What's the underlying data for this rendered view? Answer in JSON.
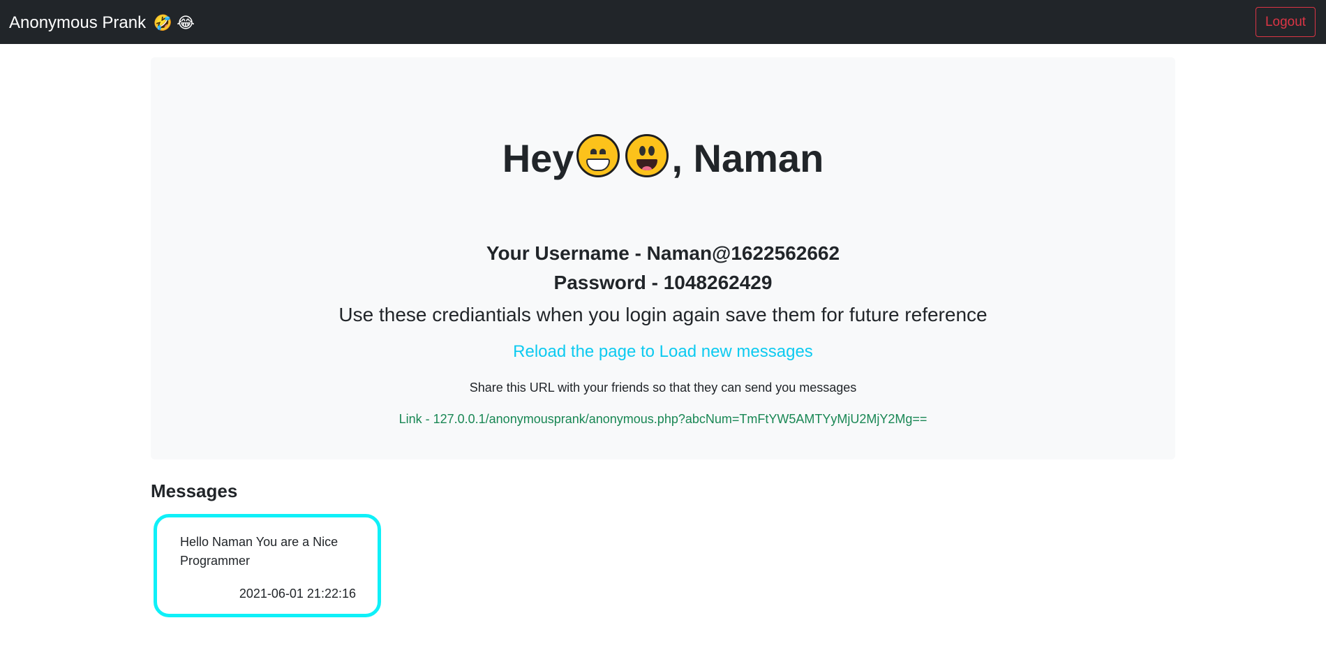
{
  "navbar": {
    "brand": "Anonymous Prank",
    "brand_emoji": "🤣 😂",
    "logout_label": "Logout"
  },
  "hero": {
    "greeting_prefix": "Hey",
    "greeting_suffix": ", Naman",
    "username_line": "Your Username - Naman@1622562662",
    "password_line": "Password - 1048262429",
    "note": "Use these crediantials when you login again save them for future reference",
    "reload_link": "Reload the page to Load new messages",
    "share_text": "Share this URL with your friends so that they can send you messages",
    "share_link": "Link - 127.0.0.1/anonymousprank/anonymous.php?abcNum=TmFtYW5AMTYyMjU2MjY2Mg=="
  },
  "messages": {
    "heading": "Messages",
    "items": [
      {
        "text": "Hello Naman You are a Nice Programmer",
        "timestamp": "2021-06-01 21:22:16"
      }
    ]
  },
  "colors": {
    "navbar_bg": "#212529",
    "logout": "#dc3545",
    "reload_link": "#0dcaf0",
    "share_link": "#198754",
    "card_border": "#0ff0f8"
  }
}
